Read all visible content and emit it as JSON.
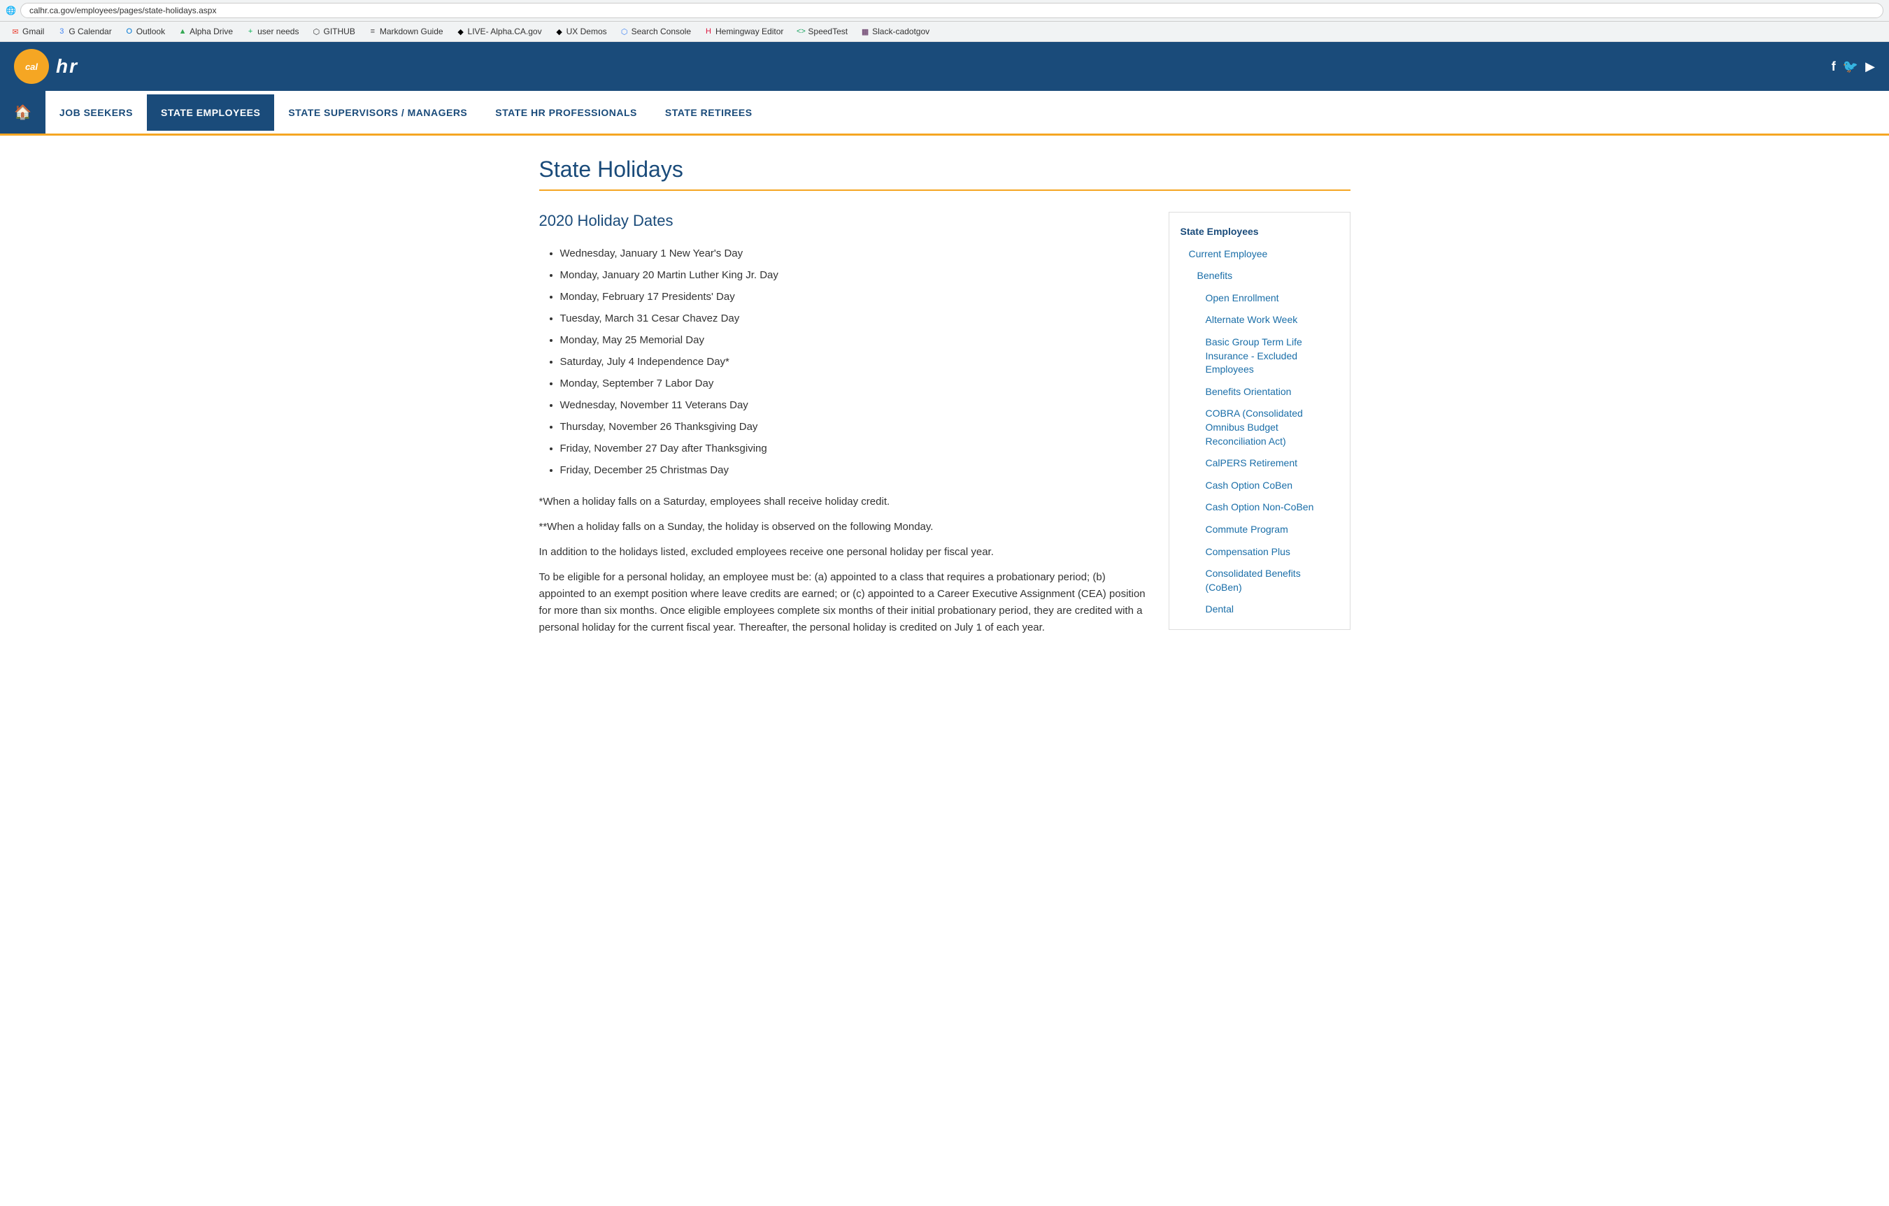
{
  "browser": {
    "url": "calhr.ca.gov/employees/pages/state-holidays.aspx",
    "favicon": "🌐"
  },
  "bookmarks": [
    {
      "id": "gmail",
      "label": "Gmail",
      "icon": "✉",
      "color": "#EA4335"
    },
    {
      "id": "gcalendar",
      "label": "G Calendar",
      "icon": "3",
      "color": "#4285F4"
    },
    {
      "id": "outlook",
      "label": "Outlook",
      "icon": "O",
      "color": "#0078D4"
    },
    {
      "id": "alphadrive",
      "label": "Alpha Drive",
      "icon": "▲",
      "color": "#34A853"
    },
    {
      "id": "userneeds",
      "label": "user needs",
      "icon": "+",
      "color": "#00B050"
    },
    {
      "id": "github",
      "label": "GITHUB",
      "icon": "⬡",
      "color": "#333"
    },
    {
      "id": "markdown",
      "label": "Markdown Guide",
      "icon": "≡",
      "color": "#555"
    },
    {
      "id": "live",
      "label": "LIVE- Alpha.CA.gov",
      "icon": "◆",
      "color": "#000"
    },
    {
      "id": "uxdemos",
      "label": "UX Demos",
      "icon": "◆",
      "color": "#000"
    },
    {
      "id": "searchconsole",
      "label": "Search Console",
      "icon": "⬡",
      "color": "#4285F4"
    },
    {
      "id": "hemingway",
      "label": "Hemingway Editor",
      "icon": "H",
      "color": "#DC143C"
    },
    {
      "id": "speedtest",
      "label": "SpeedTest",
      "icon": "<>",
      "color": "#1DA462"
    },
    {
      "id": "slack",
      "label": "Slack-cadotgov",
      "icon": "▦",
      "color": "#4A154B"
    }
  ],
  "header": {
    "logo_text": "cal",
    "social": [
      "f",
      "🐦",
      "▶"
    ]
  },
  "nav": {
    "home_label": "🏠",
    "items": [
      {
        "id": "job-seekers",
        "label": "JOB SEEKERS",
        "active": false
      },
      {
        "id": "state-employees",
        "label": "STATE EMPLOYEES",
        "active": true
      },
      {
        "id": "supervisors",
        "label": "STATE SUPERVISORS / MANAGERS",
        "active": false
      },
      {
        "id": "hr-professionals",
        "label": "STATE HR PROFESSIONALS",
        "active": false
      },
      {
        "id": "retirees",
        "label": "STATE RETIREES",
        "active": false
      }
    ]
  },
  "page": {
    "title": "State Holidays",
    "section_title": "2020 Holiday Dates",
    "holidays": [
      "Wednesday, January 1 New Year's Day",
      "Monday, January 20 Martin Luther King Jr. Day",
      "Monday, February 17 Presidents' Day",
      "Tuesday, March 31 Cesar Chavez Day",
      "Monday, May 25 Memorial Day",
      "Saturday, July 4 Independence Day*",
      "Monday, September 7 Labor Day",
      "Wednesday, November 11 Veterans Day",
      "Thursday, November 26 Thanksgiving Day",
      "Friday, November 27 Day after Thanksgiving",
      "Friday, December 25 Christmas Day"
    ],
    "notes": [
      "*When a holiday falls on a Saturday, employees shall receive holiday credit.",
      "**When a holiday falls on a Sunday, the holiday is observed on the following Monday.",
      "In addition to the holidays listed, excluded employees receive one personal holiday per fiscal year.",
      "To be eligible for a personal holiday, an employee must be: (a) appointed to a class that requires a probationary period; (b) appointed to an exempt position where leave credits are earned; or (c) appointed to a Career Executive Assignment (CEA) position for more than six months.  Once eligible employees complete six months of their initial probationary period, they are credited with a personal holiday for the current fiscal year.  Thereafter, the personal holiday is credited on July 1 of each year."
    ]
  },
  "sidebar": {
    "items": [
      {
        "id": "state-employees",
        "label": "State Employees",
        "level": 1
      },
      {
        "id": "current-employee",
        "label": "Current Employee",
        "level": 2
      },
      {
        "id": "benefits",
        "label": "Benefits",
        "level": 3
      },
      {
        "id": "open-enrollment",
        "label": "Open Enrollment",
        "level": 4
      },
      {
        "id": "alternate-work-week",
        "label": "Alternate Work Week",
        "level": 4
      },
      {
        "id": "basic-group-term",
        "label": "Basic Group Term Life Insurance - Excluded Employees",
        "level": 4
      },
      {
        "id": "benefits-orientation",
        "label": "Benefits Orientation",
        "level": 4
      },
      {
        "id": "cobra",
        "label": "COBRA (Consolidated Omnibus Budget Reconciliation Act)",
        "level": 4
      },
      {
        "id": "calpers",
        "label": "CalPERS Retirement",
        "level": 4
      },
      {
        "id": "cash-option-coben",
        "label": "Cash Option CoBen",
        "level": 4
      },
      {
        "id": "cash-option-non-coben",
        "label": "Cash Option Non-CoBen",
        "level": 4
      },
      {
        "id": "commute-program",
        "label": "Commute Program",
        "level": 4
      },
      {
        "id": "compensation-plus",
        "label": "Compensation Plus",
        "level": 4
      },
      {
        "id": "consolidated-benefits",
        "label": "Consolidated Benefits (CoBen)",
        "level": 4
      },
      {
        "id": "dental",
        "label": "Dental",
        "level": 4
      }
    ]
  }
}
